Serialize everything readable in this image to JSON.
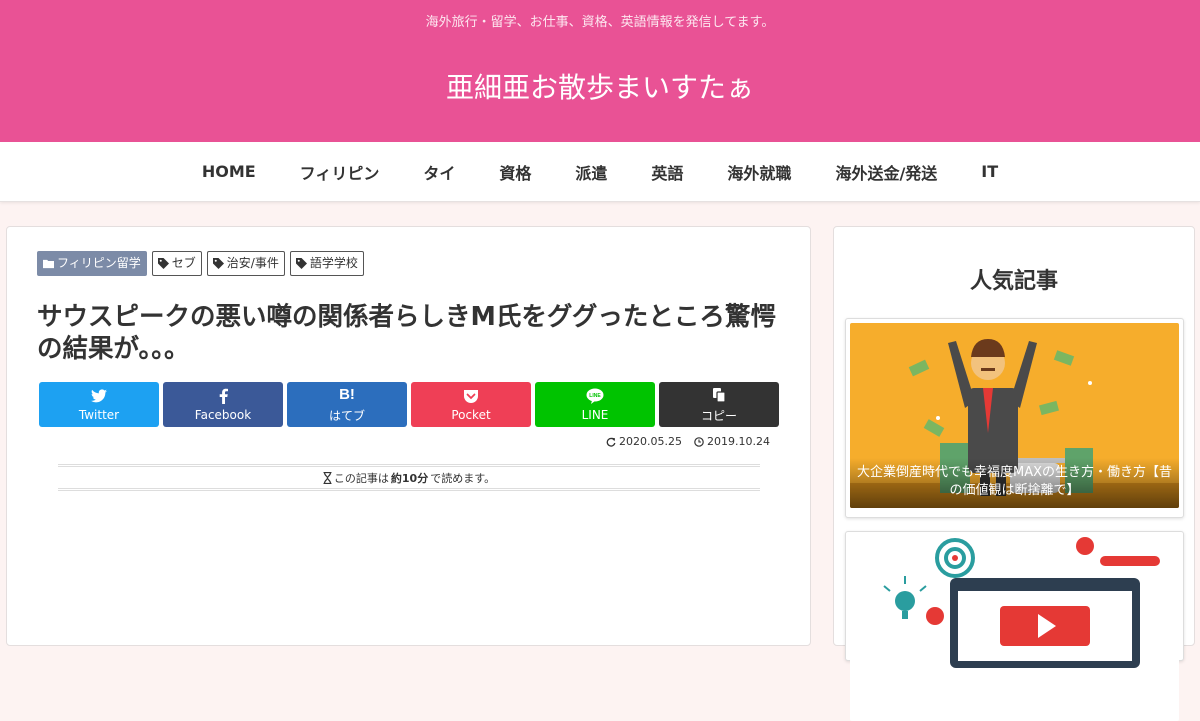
{
  "header": {
    "tagline": "海外旅行・留学、お仕事、資格、英語情報を発信してます。",
    "site_name": "亜細亜お散歩まいすたぁ",
    "brand_color": "#e95295"
  },
  "nav": {
    "items": [
      {
        "label": "HOME"
      },
      {
        "label": "フィリピン"
      },
      {
        "label": "タイ"
      },
      {
        "label": "資格"
      },
      {
        "label": "派遣"
      },
      {
        "label": "英語"
      },
      {
        "label": "海外就職"
      },
      {
        "label": "海外送金/発送"
      },
      {
        "label": "IT"
      }
    ]
  },
  "article": {
    "categories": [
      {
        "label": "フィリピン留学",
        "icon": "folder-icon"
      },
      {
        "label": "セブ",
        "icon": "tag-icon"
      },
      {
        "label": "治安/事件",
        "icon": "tag-icon"
      },
      {
        "label": "語学学校",
        "icon": "tag-icon"
      }
    ],
    "title": "サウスピークの悪い噂の関係者らしきM氏をググったところ驚愕の結果が。。。",
    "share": [
      {
        "label": "Twitter",
        "icon": "twitter-icon",
        "color": "#1da1f2"
      },
      {
        "label": "Facebook",
        "icon": "facebook-icon",
        "color": "#3b5998"
      },
      {
        "label": "はてブ",
        "icon": "hatena-bookmark-icon",
        "glyph": "B!",
        "color": "#2c6ebd"
      },
      {
        "label": "Pocket",
        "icon": "pocket-icon",
        "color": "#ef3f56"
      },
      {
        "label": "LINE",
        "icon": "line-icon",
        "color": "#00c300"
      },
      {
        "label": "コピー",
        "icon": "copy-icon",
        "color": "#333333"
      }
    ],
    "updated_date": "2020.05.25",
    "published_date": "2019.10.24",
    "read_time": {
      "prefix": "この記事は",
      "value": "約10分",
      "suffix": "で読めます。"
    }
  },
  "sidebar": {
    "widget_title": "人気記事",
    "popular": [
      {
        "caption": "大企業倒産時代でも幸福度MAXの生き方・働き方【昔の価値観は断捨離で】"
      },
      {
        "caption": ""
      }
    ]
  }
}
